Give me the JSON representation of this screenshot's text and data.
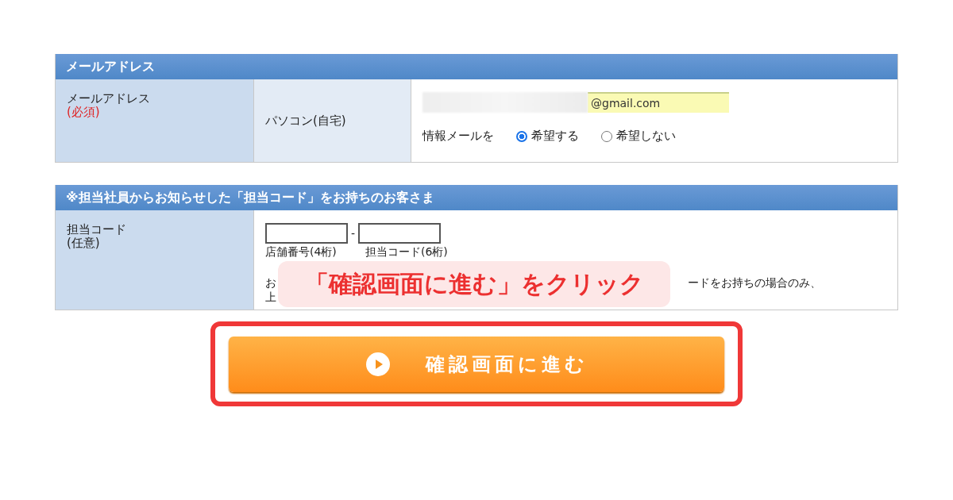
{
  "email_section": {
    "title": "メールアドレス",
    "label": "メールアドレス",
    "required": "(必須)",
    "sub_label": "パソコン(自宅)",
    "email_value": "@gmail.com",
    "newsletter_label": "情報メールを",
    "options": [
      {
        "label": "希望する",
        "selected": true
      },
      {
        "label": "希望しない",
        "selected": false
      }
    ]
  },
  "code_section": {
    "title": "※担当社員からお知らせした「担当コード」をお持ちのお客さま",
    "label": "担当コード",
    "optional": "(任意)",
    "separator": "-",
    "field_captions": [
      "店舗番号(4桁)",
      "担当コード(6桁)"
    ],
    "note_line_1_start": "お",
    "note_line_1_end": "ードをお持ちの場合のみ、",
    "note_line_2": "上"
  },
  "callout": "「確認画面に進む」をクリック",
  "submit_button": {
    "label": "確認画面に進む",
    "highlighted": true
  }
}
